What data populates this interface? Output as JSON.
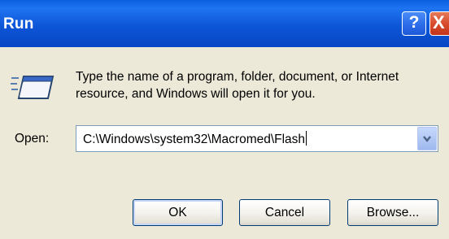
{
  "window": {
    "title": "Run",
    "help_label": "?",
    "close_label": "X"
  },
  "dialog": {
    "description": "Type the name of a program, folder, document, or Internet resource, and Windows will open it for you.",
    "open_label": "Open:",
    "open_value": "C:\\Windows\\system32\\Macromed\\Flash"
  },
  "buttons": {
    "ok": "OK",
    "cancel": "Cancel",
    "browse": "Browse..."
  },
  "colors": {
    "titlebar": "#0a5fe0",
    "dialog_bg": "#ece9d8",
    "close_button": "#d6492a"
  },
  "icons": {
    "run_icon": "run-window-icon",
    "dropdown": "chevron-down-icon"
  }
}
